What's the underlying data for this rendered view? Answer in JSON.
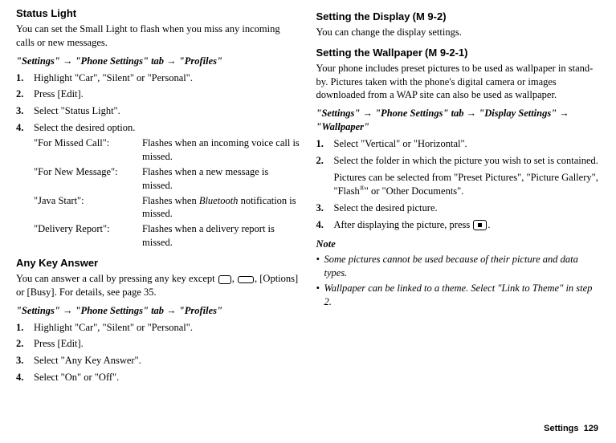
{
  "left": {
    "statusLight": {
      "heading": "Status Light",
      "intro": "You can set the Small Light to flash when you miss any incoming calls or new messages.",
      "path": "\"Settings\" → \"Phone Settings\" tab → \"Profiles\"",
      "steps": [
        "Highlight \"Car\", \"Silent\" or \"Personal\".",
        "Press [Edit].",
        "Select \"Status Light\".",
        "Select the desired option."
      ],
      "options": [
        {
          "label": "\"For Missed Call\":",
          "desc": "Flashes when an incoming voice call is missed."
        },
        {
          "label": "\"For New Message\":",
          "desc": "Flashes when a new message is missed."
        },
        {
          "label": "\"Java Start\":",
          "descPrefix": "Flashes when ",
          "descItalic": "Bluetooth",
          "descSuffix": " notification is missed."
        },
        {
          "label": "\"Delivery Report\":",
          "desc": "Flashes when a delivery report is missed."
        }
      ]
    },
    "anyKey": {
      "heading": "Any Key Answer",
      "introPrefix": "You can answer a call by pressing any key except ",
      "introMid": ", ",
      "introSuffix": ", [Options] or [Busy]. For details, see page 35.",
      "path": "\"Settings\" → \"Phone Settings\" tab → \"Profiles\"",
      "steps": [
        "Highlight \"Car\", \"Silent\" or \"Personal\".",
        "Press [Edit].",
        "Select \"Any Key Answer\".",
        "Select \"On\" or \"Off\"."
      ]
    }
  },
  "right": {
    "display": {
      "heading": "Setting the Display",
      "code": "(M 9-2)",
      "intro": "You can change the display settings."
    },
    "wallpaper": {
      "heading": "Setting the Wallpaper",
      "code": "(M 9-2-1)",
      "intro": "Your phone includes preset pictures to be used as wallpaper in stand-by. Pictures taken with the phone's digital camera or images downloaded from a WAP site can also be used as wallpaper.",
      "path": "\"Settings\" → \"Phone Settings\" tab → \"Display Settings\" → \"Wallpaper\"",
      "step1": "Select \"Vertical\" or \"Horizontal\".",
      "step2": "Select the folder in which the picture you wish to set is contained.",
      "step2notePrefix": "Pictures can be selected from \"Preset Pictures\", \"Picture Gallery\", \"Flash",
      "step2noteSup": "®",
      "step2noteSuffix": "\" or \"Other Documents\".",
      "step3": "Select the desired picture.",
      "step4Prefix": "After displaying the picture, press ",
      "step4Suffix": "."
    },
    "note": {
      "heading": "Note",
      "items": [
        "Some pictures cannot be used because of their picture and data types.",
        "Wallpaper can be linked to a theme. Select \"Link to Theme\" in step 2."
      ]
    }
  },
  "footer": {
    "label": "Settings",
    "page": "129"
  }
}
